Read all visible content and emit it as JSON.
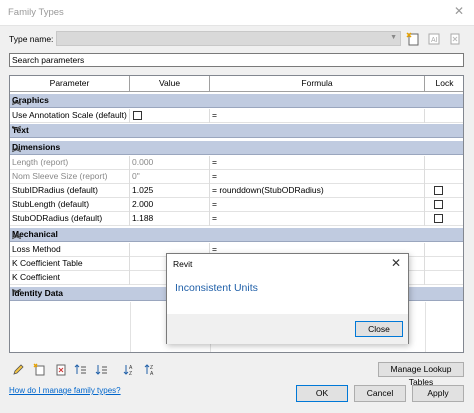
{
  "window": {
    "title": "Family Types",
    "close_glyph": "✕"
  },
  "type_name": {
    "label": "Type name:",
    "value": ""
  },
  "search": {
    "placeholder": "Search parameters"
  },
  "columns": [
    "Parameter",
    "Value",
    "Formula",
    "Lock"
  ],
  "groups": [
    {
      "name": "Graphics",
      "state": "expanded"
    },
    {
      "name": "Text",
      "state": "collapsed"
    },
    {
      "name": "Dimensions",
      "state": "expanded"
    },
    {
      "name": "Mechanical",
      "state": "expanded"
    },
    {
      "name": "Identity Data",
      "state": "collapsed"
    }
  ],
  "rows": {
    "graphics": [
      {
        "parameter": "Use Annotation Scale (default)",
        "value": "",
        "formula": "=",
        "lock": null
      }
    ],
    "dimensions": [
      {
        "parameter": "Length (report)",
        "value": "0.000",
        "formula": "=",
        "lock": null,
        "readonly": true
      },
      {
        "parameter": "Nom Sleeve Size (report)",
        "value": "0\"",
        "formula": "=",
        "lock": null,
        "readonly": true
      },
      {
        "parameter": "StubIDRadius (default)",
        "value": "1.025",
        "formula": "= rounddown(StubODRadius)",
        "lock": false
      },
      {
        "parameter": "StubLength (default)",
        "value": "2.000",
        "formula": "=",
        "lock": false
      },
      {
        "parameter": "StubODRadius (default)",
        "value": "1.188",
        "formula": "=",
        "lock": false
      }
    ],
    "mechanical": [
      {
        "parameter": "Loss Method",
        "value": "",
        "formula": "=",
        "lock": null
      },
      {
        "parameter": "K Coefficient Table",
        "value": "",
        "formula": "",
        "lock": null
      },
      {
        "parameter": "K Coefficient",
        "value": "",
        "formula": "",
        "lock": null
      }
    ]
  },
  "dialog": {
    "title": "Revit",
    "message": "Inconsistent Units",
    "close_label": "Close",
    "close_glyph": "✕"
  },
  "footer": {
    "manage_lookup_label": "Manage Lookup Tables",
    "help_link": "How do I manage family types?",
    "ok_label": "OK",
    "cancel_label": "Cancel",
    "apply_label": "Apply"
  },
  "colors": {
    "group_header": "#c0cbe0",
    "link": "#0066cc",
    "dialog_message": "#1f5fa8",
    "accent": "#0078d7"
  },
  "icons": {
    "toolbar": [
      "new-type-icon",
      "rename-type-icon",
      "delete-type-icon"
    ],
    "bottom": [
      "edit-parameter-icon",
      "new-parameter-icon",
      "delete-parameter-icon",
      "move-up-icon",
      "move-down-icon",
      "sort-ascending-icon",
      "sort-descending-icon"
    ]
  }
}
